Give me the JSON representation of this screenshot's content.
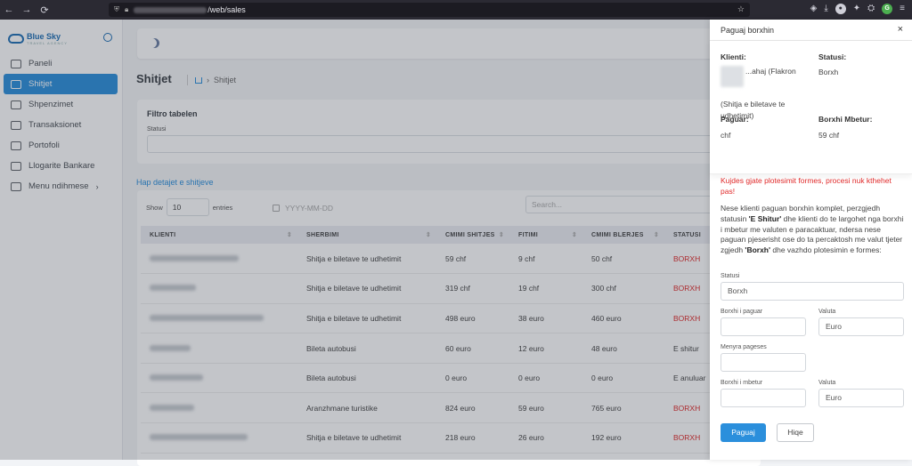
{
  "browser": {
    "url_suffix": "/web/sales",
    "back": "←",
    "forward": "→",
    "reload": "⟳",
    "star": "☆"
  },
  "sidebar": {
    "brand": "Blue Sky",
    "brand_sub": "TRAVEL AGENCY",
    "items": [
      {
        "label": "Paneli",
        "icon": "home-icon"
      },
      {
        "label": "Shitjet",
        "icon": "cart-icon",
        "active": true
      },
      {
        "label": "Shpenzimet",
        "icon": "wallet-icon"
      },
      {
        "label": "Transaksionet",
        "icon": "activity-icon"
      },
      {
        "label": "Portofoli",
        "icon": "briefcase-icon"
      },
      {
        "label": "Llogarite Bankare",
        "icon": "bank-icon"
      },
      {
        "label": "Menu ndihmese",
        "icon": "book-icon",
        "chevron": "›"
      }
    ]
  },
  "page": {
    "title": "Shitjet",
    "breadcrumb": "Shitjet"
  },
  "filter": {
    "title": "Filtro tabelen",
    "status_label": "Statusi"
  },
  "details_link": "Hap detajet e shitjeve",
  "table": {
    "show_label": "Show",
    "entries_value": "10",
    "entries_label": "entries",
    "date_placeholder": "YYYY-MM-DD",
    "search_placeholder": "Search...",
    "headers": [
      "KLIENTI",
      "SHERBIMI",
      "CMIMI SHITJES",
      "FITIMI",
      "CMIMI BLERJES",
      "STATUSI"
    ],
    "rows": [
      {
        "sherbimi": "Shitja e biletave te udhetimit",
        "shitjes": "59 chf",
        "fitimi": "9 chf",
        "blerjes": "50 chf",
        "statusi": "BORXH"
      },
      {
        "sherbimi": "Shitja e biletave te udhetimit",
        "shitjes": "319 chf",
        "fitimi": "19 chf",
        "blerjes": "300 chf",
        "statusi": "BORXH"
      },
      {
        "sherbimi": "Shitja e biletave te udhetimit",
        "shitjes": "498 euro",
        "fitimi": "38 euro",
        "blerjes": "460 euro",
        "statusi": "BORXH"
      },
      {
        "sherbimi": "Bileta autobusi",
        "shitjes": "60 euro",
        "fitimi": "12 euro",
        "blerjes": "48 euro",
        "statusi": "E shitur"
      },
      {
        "sherbimi": "Bileta autobusi",
        "shitjes": "0 euro",
        "fitimi": "0 euro",
        "blerjes": "0 euro",
        "statusi": "E anuluar"
      },
      {
        "sherbimi": "Aranzhmane turistike",
        "shitjes": "824 euro",
        "fitimi": "59 euro",
        "blerjes": "765 euro",
        "statusi": "BORXH"
      },
      {
        "sherbimi": "Shitja e biletave te udhetimit",
        "shitjes": "218 euro",
        "fitimi": "26 euro",
        "blerjes": "192 euro",
        "statusi": "BORXH"
      }
    ]
  },
  "panel": {
    "title": "Paguaj borxhin",
    "close": "×",
    "klienti_label": "Klienti:",
    "klienti_value": "...ahaj (Flakron",
    "klienti_note": "(Shitja e biletave te udhetimit)",
    "statusi_label": "Statusi:",
    "statusi_value": "Borxh",
    "paguar_label": "Paguar:",
    "paguar_value": "chf",
    "mbetur_label": "Borxhi Mbetur:",
    "mbetur_value": "59 chf",
    "warning": "Kujdes gjate plotesimit formes, procesi nuk kthehet pas!",
    "desc_1": "Nese klienti paguan borxhin komplet, perzgjedh statusin ",
    "desc_b1": "'E Shitur'",
    "desc_2": " dhe klienti do te largohet nga borxhi i mbetur me valuten e paracaktuar, ndersa nese paguan pjeserisht ose do ta percaktosh me valut tjeter zgjedh ",
    "desc_b2": "'Borxh'",
    "desc_3": " dhe vazhdo plotesimin e formes:",
    "form": {
      "statusi_label": "Statusi",
      "statusi_value": "Borxh",
      "paguar_label": "Borxhi i paguar",
      "valuta1_label": "Valuta",
      "valuta1_value": "Euro",
      "menyra_label": "Menyra pageses",
      "mbetur_label": "Borxhi i mbetur",
      "valuta2_label": "Valuta",
      "valuta2_value": "Euro"
    },
    "submit": "Paguaj",
    "cancel": "Hiqe"
  }
}
